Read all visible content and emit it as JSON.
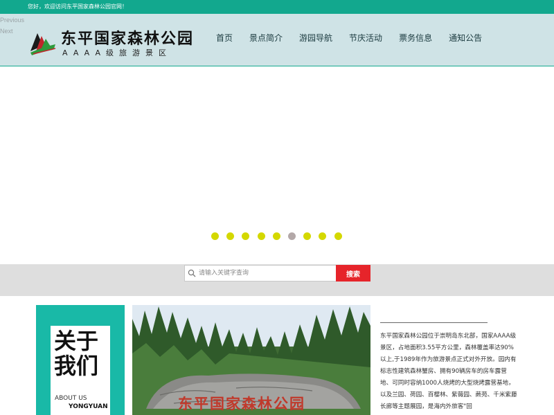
{
  "topbar": {
    "welcome": "您好，欢迎访问东平国家森林公园官网！"
  },
  "slider": {
    "prev_label": "Previous",
    "next_label": "Next",
    "active_dot": 5,
    "dot_count": 9
  },
  "logo": {
    "title": "东平国家森林公园",
    "subtitle": "AAAA级旅游景区"
  },
  "nav": [
    {
      "label": "首页"
    },
    {
      "label": "景点简介"
    },
    {
      "label": "游园导航"
    },
    {
      "label": "节庆活动"
    },
    {
      "label": "票务信息"
    },
    {
      "label": "通知公告"
    }
  ],
  "search": {
    "placeholder": "请输入关键字查询",
    "value": "",
    "button_label": "搜索"
  },
  "about": {
    "title_cn": "关于我们",
    "title_en_1": "ABOUT US",
    "title_en_2": "YONGYUAN"
  },
  "photo": {
    "stone_text": "东平国家森林公园"
  },
  "intro": {
    "text": "东平国家森林公园位于崇明岛东北部，国家AAAA级景区，占地面积3.55平方公里，森林覆盖率达90%以上,于1989年作为旅游景点正式对外开放。园内有标志性建筑森林蟹房、拥有90辆房车的房车露营地、可同时容纳1000人烧烤的大型烧烤露营基地，以及兰园、荷园、百樱林、紫薇园、蕨苑、千米紫藤长廊等主题展园，是海内外旅客\"回"
  },
  "colors": {
    "brand": "#12a88e",
    "header_bg": "#cfe3e6",
    "dot": "#d4d800",
    "dot_active": "#b3a8a8",
    "search_button": "#e6242a",
    "about_card": "#19b9a7"
  }
}
